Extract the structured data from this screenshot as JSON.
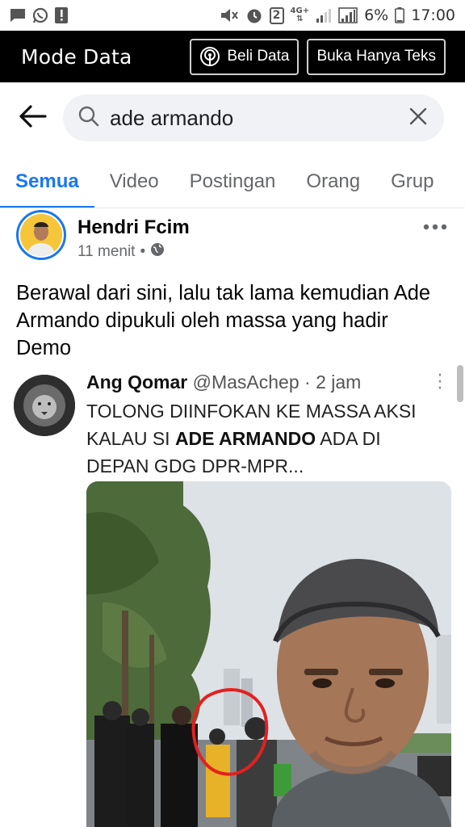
{
  "status_bar": {
    "battery_percent": "6%",
    "time": "17:00",
    "network": "4G+",
    "sim_badge": "2",
    "icons": [
      "message-icon",
      "whatsapp-icon",
      "alert-icon",
      "mute-icon",
      "alarm-icon",
      "sim-badge-icon",
      "signal-icon",
      "battery-icon"
    ]
  },
  "mode_bar": {
    "title": "Mode Data",
    "buy_data_label": "Beli Data",
    "text_only_label": "Buka Hanya Teks"
  },
  "search": {
    "query": "ade armando",
    "back_icon": "arrow-left-icon",
    "search_icon": "magnifier-icon",
    "clear_icon": "close-icon"
  },
  "tabs": [
    {
      "label": "Semua",
      "active": true
    },
    {
      "label": "Video",
      "active": false
    },
    {
      "label": "Postingan",
      "active": false
    },
    {
      "label": "Orang",
      "active": false
    },
    {
      "label": "Grup",
      "active": false
    }
  ],
  "post": {
    "author": "Hendri Fcim",
    "time": "11 menit",
    "separator": "•",
    "privacy_icon": "globe-icon",
    "text": "Berawal dari sini, lalu tak lama kemudian Ade Armando dipukuli oleh massa yang hadir Demo"
  },
  "embedded_tweet": {
    "name": "Ang Qomar",
    "handle": "@MasAchep",
    "separator": "·",
    "time": "2 jam",
    "text_part1": "TOLONG DIINFOKAN KE MASSA AKSI KALAU SI ",
    "text_bold": "ADE ARMANDO",
    "text_part2": " ADA DI DEPAN GDG DPR-MPR...",
    "photo_desc": "photo",
    "annotation_color": "#e32020"
  },
  "colors": {
    "accent": "#1877f2",
    "mode_bar_bg": "#000000",
    "search_bg": "#f0f2f5",
    "text_muted": "#65676b"
  }
}
